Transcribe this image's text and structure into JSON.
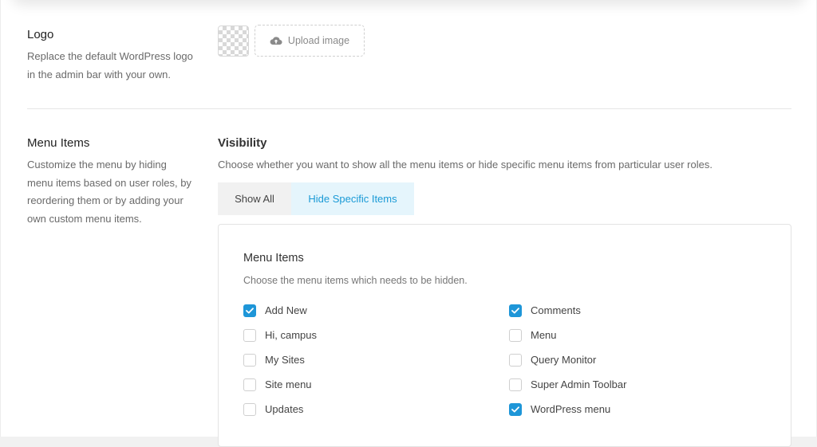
{
  "logo": {
    "heading": "Logo",
    "description_line1": "Replace the default WordPress logo",
    "description_line2": "in the admin bar with your own.",
    "upload_label": "Upload image",
    "upload_icon": "cloud-upload-icon"
  },
  "menu_items_section": {
    "heading": "Menu Items",
    "description_lines": [
      "Customize the menu by hiding",
      "menu items based on user roles, by",
      "reordering them or by adding your",
      "own custom menu items."
    ]
  },
  "visibility": {
    "title": "Visibility",
    "description": "Choose whether you want to show all the menu items or hide specific menu items from particular user roles.",
    "tabs": [
      {
        "label": "Show All",
        "active": false
      },
      {
        "label": "Hide Specific Items",
        "active": true
      }
    ]
  },
  "menu_box": {
    "title": "Menu Items",
    "description": "Choose the menu items which needs to be hidden.",
    "left_items": [
      {
        "label": "Add New",
        "checked": true
      },
      {
        "label": "Hi, campus",
        "checked": false
      },
      {
        "label": "My Sites",
        "checked": false
      },
      {
        "label": "Site menu",
        "checked": false
      },
      {
        "label": "Updates",
        "checked": false
      }
    ],
    "right_items": [
      {
        "label": "Comments",
        "checked": true
      },
      {
        "label": "Menu",
        "checked": false
      },
      {
        "label": "Query Monitor",
        "checked": false
      },
      {
        "label": "Super Admin Toolbar",
        "checked": false
      },
      {
        "label": "WordPress menu",
        "checked": true
      }
    ]
  },
  "colors": {
    "accent": "#1e96d8",
    "active_tab_bg": "#e5f5fc",
    "active_tab_text": "#1a9ad6"
  }
}
